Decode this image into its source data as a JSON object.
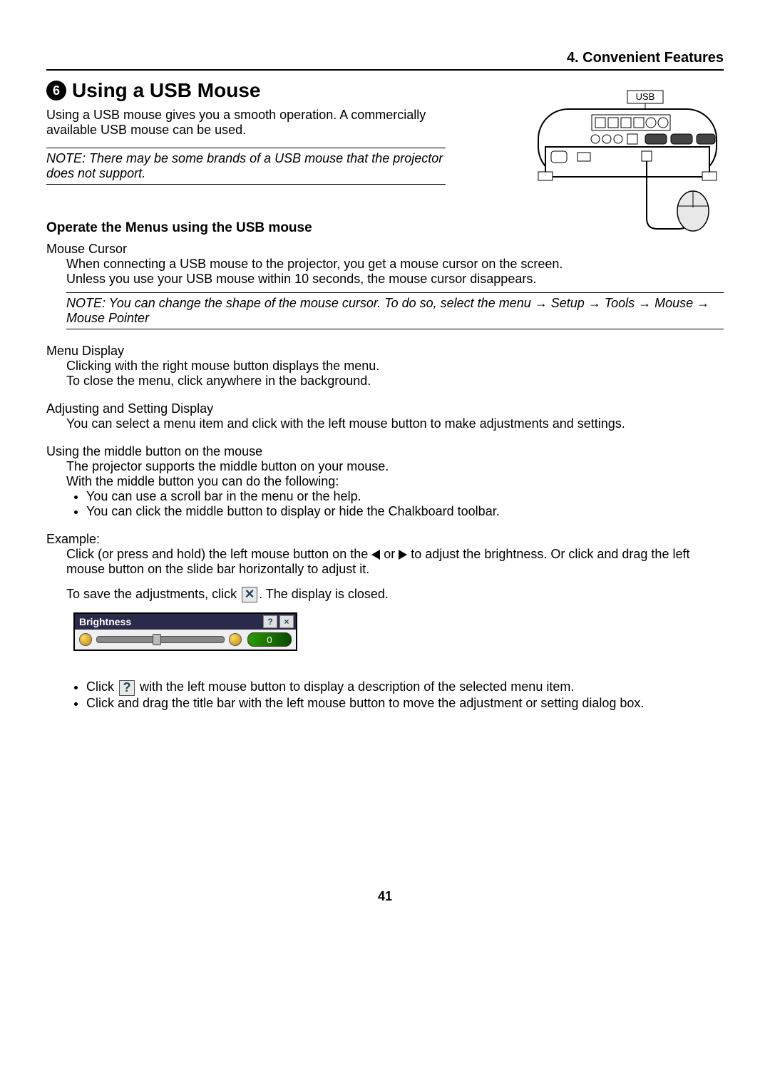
{
  "chapter": "4. Convenient Features",
  "section_number": "6",
  "section_title": "Using a USB Mouse",
  "intro": "Using a USB mouse gives you a smooth operation. A commercially available USB mouse can be used.",
  "note1": "NOTE: There may be some brands of a USB mouse that the projector does not support.",
  "diagram_label": "USB",
  "subhead": "Operate the Menus using the USB mouse",
  "mouse_cursor": {
    "title": "Mouse Cursor",
    "p1": "When connecting a USB mouse to the projector, you get a mouse cursor on the screen.",
    "p2": "Unless you use your USB mouse within 10 seconds, the mouse cursor disappears.",
    "note": "NOTE: You can change the shape of the mouse cursor. To do so, select the menu → Setup → Tools → Mouse → Mouse Pointer"
  },
  "menu_display": {
    "title": "Menu Display",
    "p1": "Clicking with the right mouse button displays the menu.",
    "p2": "To close the menu, click anywhere in the background."
  },
  "adjust": {
    "title": "Adjusting and Setting Display",
    "p1": "You can select a menu item and click with the left mouse button to make adjustments and settings."
  },
  "middle": {
    "title": "Using the middle button on the mouse",
    "p1": "The projector supports the middle button on your mouse.",
    "p2": "With the middle button you can do the following:",
    "b1": "You can use a scroll bar in the menu or the help.",
    "b2": "You can click the middle button to display or hide the Chalkboard toolbar."
  },
  "example": {
    "title": "Example:",
    "p1a": "Click (or press and hold) the left mouse button on the ",
    "p1b": " or ",
    "p1c": " to adjust the brightness. Or click and drag the left mouse button on the slide bar horizontally to adjust it.",
    "p2a": "To save the adjustments, click ",
    "p2b": ". The display is closed."
  },
  "slider": {
    "label": "Brightness",
    "value": "0"
  },
  "extras": {
    "b1a": "Click ",
    "b1b": " with the left mouse button to display a description of the selected menu item.",
    "b2": "Click and drag the title bar with the left mouse button to move the adjustment or setting dialog box."
  },
  "page_num": "41"
}
